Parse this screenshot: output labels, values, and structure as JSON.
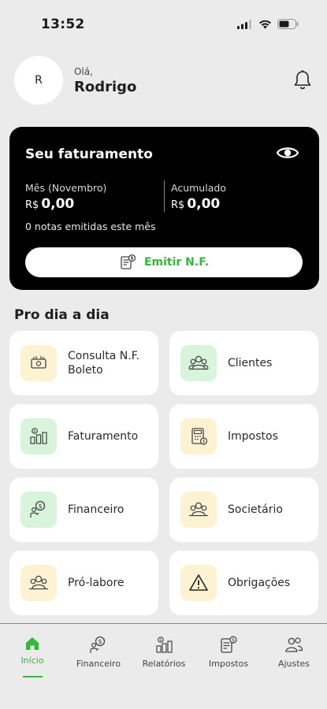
{
  "status_bar": {
    "time": "13:52"
  },
  "header": {
    "avatar_initial": "R",
    "greeting": "Olá,",
    "user_name": "Rodrigo"
  },
  "revenue_card": {
    "title": "Seu faturamento",
    "month_label": "Mês (Novembro)",
    "month_currency": "R$",
    "month_value": "0,00",
    "accumulated_label": "Acumulado",
    "accumulated_currency": "R$",
    "accumulated_value": "0,00",
    "notes_text": "0 notas emitidas este mês",
    "emit_button_label": "Emitir N.F."
  },
  "section": {
    "title": "Pro dia a dia"
  },
  "tiles": [
    {
      "label": "Consulta N.F.\nBoleto",
      "icon": "money-icon",
      "bg": "yellow"
    },
    {
      "label": "Clientes",
      "icon": "clients-icon",
      "bg": "green"
    },
    {
      "label": "Faturamento",
      "icon": "revenue-icon",
      "bg": "green"
    },
    {
      "label": "Impostos",
      "icon": "calculator-icon",
      "bg": "yellow"
    },
    {
      "label": "Financeiro",
      "icon": "finance-icon",
      "bg": "green"
    },
    {
      "label": "Societário",
      "icon": "partners-icon",
      "bg": "yellow"
    },
    {
      "label": "Pró-labore",
      "icon": "prolabore-icon",
      "bg": "yellow"
    },
    {
      "label": "Obrigações",
      "icon": "warning-icon",
      "bg": "yellow"
    }
  ],
  "nav": {
    "items": [
      {
        "label": "Início",
        "icon": "home-icon",
        "active": true
      },
      {
        "label": "Financeiro",
        "icon": "finance-icon",
        "active": false
      },
      {
        "label": "Relatórios",
        "icon": "reports-icon",
        "active": false
      },
      {
        "label": "Impostos",
        "icon": "taxes-icon",
        "active": false
      },
      {
        "label": "Ajustes",
        "icon": "settings-people-icon",
        "active": false
      }
    ]
  },
  "colors": {
    "accent": "#36b83a",
    "tile_yellow": "#fdf3d3",
    "tile_green": "#d8f5dc",
    "card_bg": "#000000"
  }
}
